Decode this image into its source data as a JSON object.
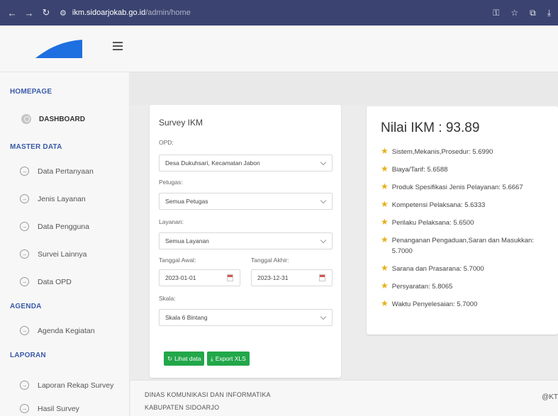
{
  "browser": {
    "url_host": "ikm.sidoarjokab.go.id",
    "url_path": "/admin/home"
  },
  "sidebar": {
    "homepage_label": "HOMEPAGE",
    "dashboard_label": "DASHBOARD",
    "master_data_label": "MASTER DATA",
    "master_items": [
      "Data Pertanyaan",
      "Jenis Layanan",
      "Data Pengguna",
      "Survei Lainnya",
      "Data OPD"
    ],
    "agenda_label": "AGENDA",
    "agenda_items": [
      "Agenda Kegiatan"
    ],
    "laporan_label": "LAPORAN",
    "laporan_items": [
      "Laporan Rekap Survey",
      "Hasil Survey"
    ]
  },
  "form": {
    "title": "Survey IKM",
    "opd_label": "OPD:",
    "opd_value": "Desa Dukuhsari, Kecamatan Jabon",
    "petugas_label": "Petugas:",
    "petugas_value": "Semua Petugas",
    "layanan_label": "Layanan:",
    "layanan_value": "Semua Layanan",
    "tanggal_awal_label": "Tanggal Awal:",
    "tanggal_awal_value": "2023-01-01",
    "tanggal_akhir_label": "Tanggal Akhir:",
    "tanggal_akhir_value": "2023-12-31",
    "skala_label": "Skala:",
    "skala_value": "Skala 6 Bintang",
    "lihat_button": "Lihat data",
    "export_button": "Export XLS"
  },
  "ikm": {
    "title": "Nilai IKM : 93.89",
    "items": [
      "Sistem,Mekanis,Prosedur: 5.6990",
      "Biaya/Tarif: 5.6588",
      "Produk Spesifikasi Jenis Pelayanan: 5.6667",
      "Kompetensi Pelaksana: 5.6333",
      "Perilaku Pelaksana: 5.6500",
      "Penanganan Pengaduan,Saran dan Masukkan: 5.7000",
      "Sarana dan Prasarana: 5.7000",
      "Persyaratan: 5.8065",
      "Waktu Penyelesaian: 5.7000"
    ]
  },
  "footer": {
    "line1": "DINAS KOMUNIKASI DAN INFORMATIKA",
    "line2": "KABUPATEN SIDOARJO",
    "right": "@KT"
  },
  "colors": {
    "chrome": "#3b4470",
    "accent": "#3a5aa8",
    "button_green": "#22a74a",
    "star": "#e5b117"
  }
}
